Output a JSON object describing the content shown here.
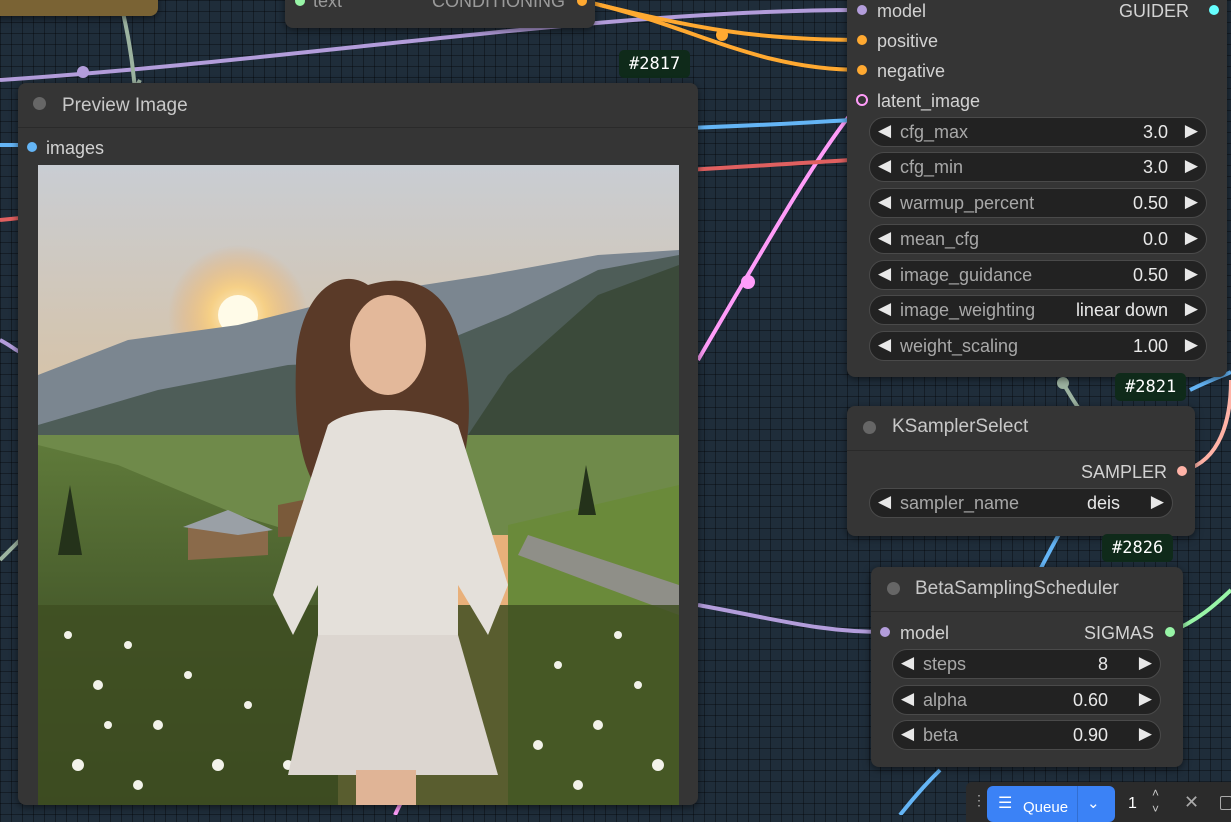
{
  "colors": {
    "wire_model": "#b39ddb",
    "wire_conditioning": "#ffa931",
    "wire_latent": "#ff9cf9",
    "wire_image": "#64b5f6",
    "wire_sigmas": "#98f5a7",
    "wire_sampler": "#ffb3a7",
    "wire_guider": "#66ffff",
    "queue_accent": "#3b82f6"
  },
  "top_node": {
    "input_label": "text",
    "output_label": "CONDITIONING"
  },
  "preview": {
    "id": "#2817",
    "title": "Preview Image",
    "input_label": "images"
  },
  "guider": {
    "inputs": [
      "model",
      "positive",
      "negative",
      "latent_image"
    ],
    "output": "GUIDER",
    "widgets": [
      {
        "label": "cfg_max",
        "value": "3.0"
      },
      {
        "label": "cfg_min",
        "value": "3.0"
      },
      {
        "label": "warmup_percent",
        "value": "0.50"
      },
      {
        "label": "mean_cfg",
        "value": "0.0"
      },
      {
        "label": "image_guidance",
        "value": "0.50"
      },
      {
        "label": "image_weighting",
        "value": "linear down"
      },
      {
        "label": "weight_scaling",
        "value": "1.00"
      }
    ]
  },
  "ksampler": {
    "id": "#2821",
    "title": "KSamplerSelect",
    "output": "SAMPLER",
    "widget": {
      "label": "sampler_name",
      "value": "deis"
    }
  },
  "beta": {
    "id": "#2826",
    "title": "BetaSamplingScheduler",
    "input": "model",
    "output": "SIGMAS",
    "widgets": [
      {
        "label": "steps",
        "value": "8"
      },
      {
        "label": "alpha",
        "value": "0.60"
      },
      {
        "label": "beta",
        "value": "0.90"
      }
    ]
  },
  "queue": {
    "label": "Queue",
    "count": "1"
  },
  "icons": {
    "left_arrow": "◀",
    "right_arrow": "▶"
  }
}
